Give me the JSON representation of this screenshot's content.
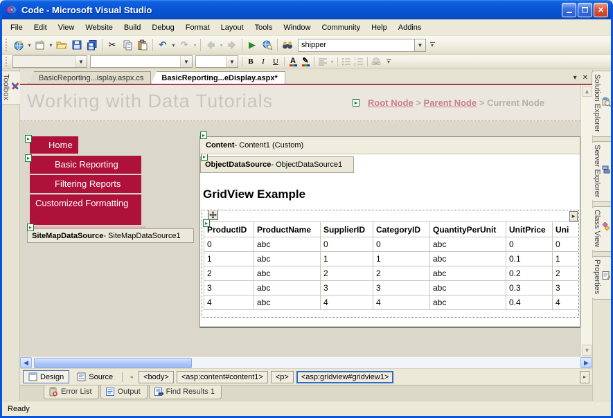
{
  "window": {
    "title": "Code - Microsoft Visual Studio"
  },
  "menubar": {
    "items": [
      "File",
      "Edit",
      "View",
      "Website",
      "Build",
      "Debug",
      "Format",
      "Layout",
      "Tools",
      "Window",
      "Community",
      "Help",
      "Addins"
    ]
  },
  "toolbar": {
    "search_value": "shipper"
  },
  "format_toolbar": {
    "bold": "B",
    "italic": "I",
    "underline": "U",
    "fontcolor": "A"
  },
  "tabs": {
    "tab1": "BasicReporting...isplay.aspx.cs",
    "tab2": "BasicReporting...eDisplay.aspx*"
  },
  "panels": {
    "toolbox": "Toolbox",
    "right_tabs": [
      "Solution Explorer",
      "Server Explorer",
      "Class View",
      "Properties"
    ]
  },
  "design": {
    "page_title": "Working with Data Tutorials",
    "breadcrumb": {
      "root": "Root Node",
      "sep1": " > ",
      "parent": "Parent Node",
      "sep2": " > ",
      "current": "Current Node"
    },
    "nav": {
      "home": "Home",
      "item1": "Basic Reporting",
      "item2": "Filtering Reports",
      "item3": "Customized Formatting"
    },
    "sitemap": {
      "type": "SiteMapDataSource",
      "rest": " - SiteMapDataSource1"
    },
    "content": {
      "type": "Content",
      "rest": " - Content1 (Custom)"
    },
    "ods": {
      "type": "ObjectDataSource",
      "rest": " - ObjectDataSource1"
    },
    "grid": {
      "heading": "GridView Example",
      "columns": [
        "ProductID",
        "ProductName",
        "SupplierID",
        "CategoryID",
        "QuantityPerUnit",
        "UnitPrice",
        "Uni"
      ],
      "rows": [
        [
          "0",
          "abc",
          "0",
          "0",
          "abc",
          "0",
          "0"
        ],
        [
          "1",
          "abc",
          "1",
          "1",
          "abc",
          "0.1",
          "1"
        ],
        [
          "2",
          "abc",
          "2",
          "2",
          "abc",
          "0.2",
          "2"
        ],
        [
          "3",
          "abc",
          "3",
          "3",
          "abc",
          "0.3",
          "3"
        ],
        [
          "4",
          "abc",
          "4",
          "4",
          "abc",
          "0.4",
          "4"
        ]
      ]
    }
  },
  "view_bar": {
    "design": "Design",
    "source": "Source",
    "tags": [
      "<body>",
      "<asp:content#content1>",
      "<p>",
      "<asp:gridview#gridview1>"
    ]
  },
  "bottom_tabs": [
    "Error List",
    "Output",
    "Find Results 1"
  ],
  "status": "Ready",
  "glyphs": {
    "cut": "✂",
    "undo": "↶",
    "redo": "↷",
    "start": "▶",
    "dropdown": "▾",
    "close": "✕",
    "tab_dropdown": "▾",
    "tab_close": "✕",
    "smart_tag": "▸",
    "expand_tag": "▸",
    "grid_handle": "✥",
    "scroll_up": "▲",
    "scroll_down": "▼",
    "scroll_left": "◀",
    "scroll_right": "▶",
    "nav_back_disabled": "◂",
    "tagnav_right": "▸"
  },
  "colors": {
    "accent_red": "#AE123A",
    "link_pink": "#C9808C",
    "selection_blue": "#2E6BC5",
    "title_gray": "#C9C5BB"
  }
}
